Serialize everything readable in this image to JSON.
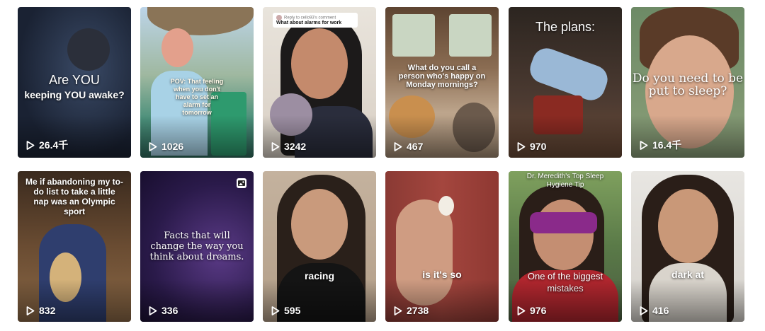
{
  "videos": [
    {
      "caption_1": "Are YOU",
      "caption_2": "keeping YOU awake?",
      "views": "26.4千"
    },
    {
      "caption": "POV: That feeling when you don't have to set an alarm for tomorrow",
      "views": "1026"
    },
    {
      "comment_header": "Reply to cello93's comment",
      "comment_text": "What about alarms for work",
      "views": "3242"
    },
    {
      "caption": "What do you call a person who's happy on Monday mornings?",
      "views": "467"
    },
    {
      "caption": "The plans:",
      "views": "970"
    },
    {
      "caption": "Do you need to be put to sleep?",
      "views": "16.4千"
    },
    {
      "caption": "Me if abandoning my to-do list to take a little nap was an Olympic sport",
      "views": "832"
    },
    {
      "caption": "Facts that will change the way you think about dreams.",
      "views": "336",
      "icon": "photo-carousel-icon"
    },
    {
      "caption": "racing",
      "views": "595"
    },
    {
      "caption": "is it's so",
      "views": "2738"
    },
    {
      "caption_top": "Dr. Meredith's Top Sleep Hygiene Tip",
      "caption_bottom": "One of the biggest mistakes",
      "views": "976"
    },
    {
      "caption": "dark at",
      "views": "416"
    }
  ],
  "colors": {
    "background": "#ffffff",
    "overlay_text": "#ffffff"
  }
}
